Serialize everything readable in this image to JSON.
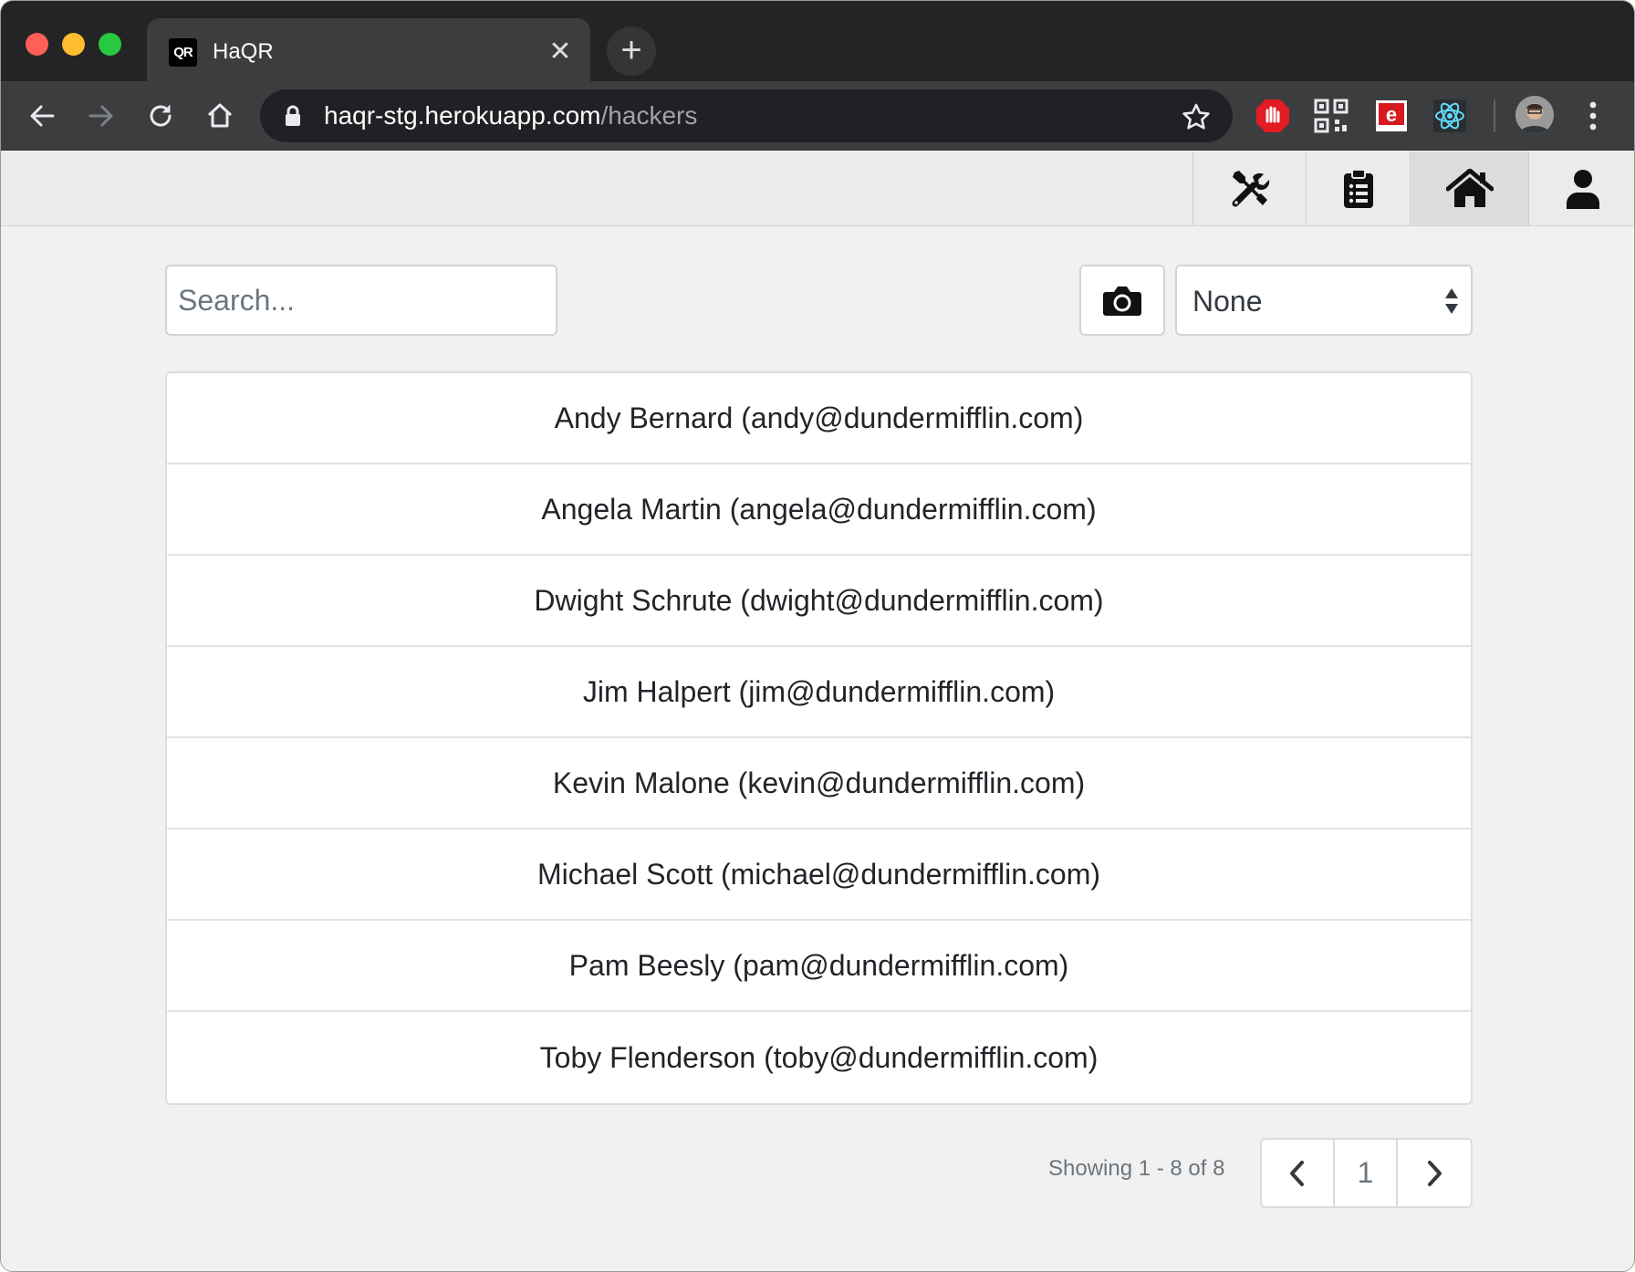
{
  "browser": {
    "tab": {
      "favicon_text": "QR",
      "title": "HaQR",
      "close_glyph": "✕"
    },
    "new_tab_glyph": "+",
    "url_host": "haqr-stg.herokuapp.com",
    "url_path": "/hackers",
    "icons": [
      "back-icon",
      "forward-icon",
      "reload-icon",
      "home-icon",
      "lock-icon",
      "star-icon",
      "ublock-icon",
      "qr-extension-icon",
      "edit-extension-icon",
      "react-devtools-icon",
      "profile-avatar",
      "menu-icon"
    ],
    "colors": {
      "tabstrip": "#232425",
      "toolbar": "#3c3d3f",
      "omnibox": "#202124",
      "ublock_red": "#e31b23",
      "react_blue": "#61dafb"
    }
  },
  "navbar": {
    "items": [
      {
        "name": "admin-tools",
        "icon": "tools-icon"
      },
      {
        "name": "clipboard",
        "icon": "clipboard-icon"
      },
      {
        "name": "home",
        "icon": "home-icon",
        "active": true
      },
      {
        "name": "account",
        "icon": "user-icon"
      }
    ]
  },
  "search": {
    "placeholder": "Search...",
    "value": ""
  },
  "camera_button": {
    "icon": "camera-icon"
  },
  "filter_select": {
    "value": "None"
  },
  "hackers": [
    "Andy Bernard (andy@dundermifflin.com)",
    "Angela Martin (angela@dundermifflin.com)",
    "Dwight Schrute (dwight@dundermifflin.com)",
    "Jim Halpert (jim@dundermifflin.com)",
    "Kevin Malone (kevin@dundermifflin.com)",
    "Michael Scott (michael@dundermifflin.com)",
    "Pam Beesly (pam@dundermifflin.com)",
    "Toby Flenderson (toby@dundermifflin.com)"
  ],
  "pagination": {
    "showing": "Showing 1 - 8 of 8",
    "current_page": "1"
  }
}
